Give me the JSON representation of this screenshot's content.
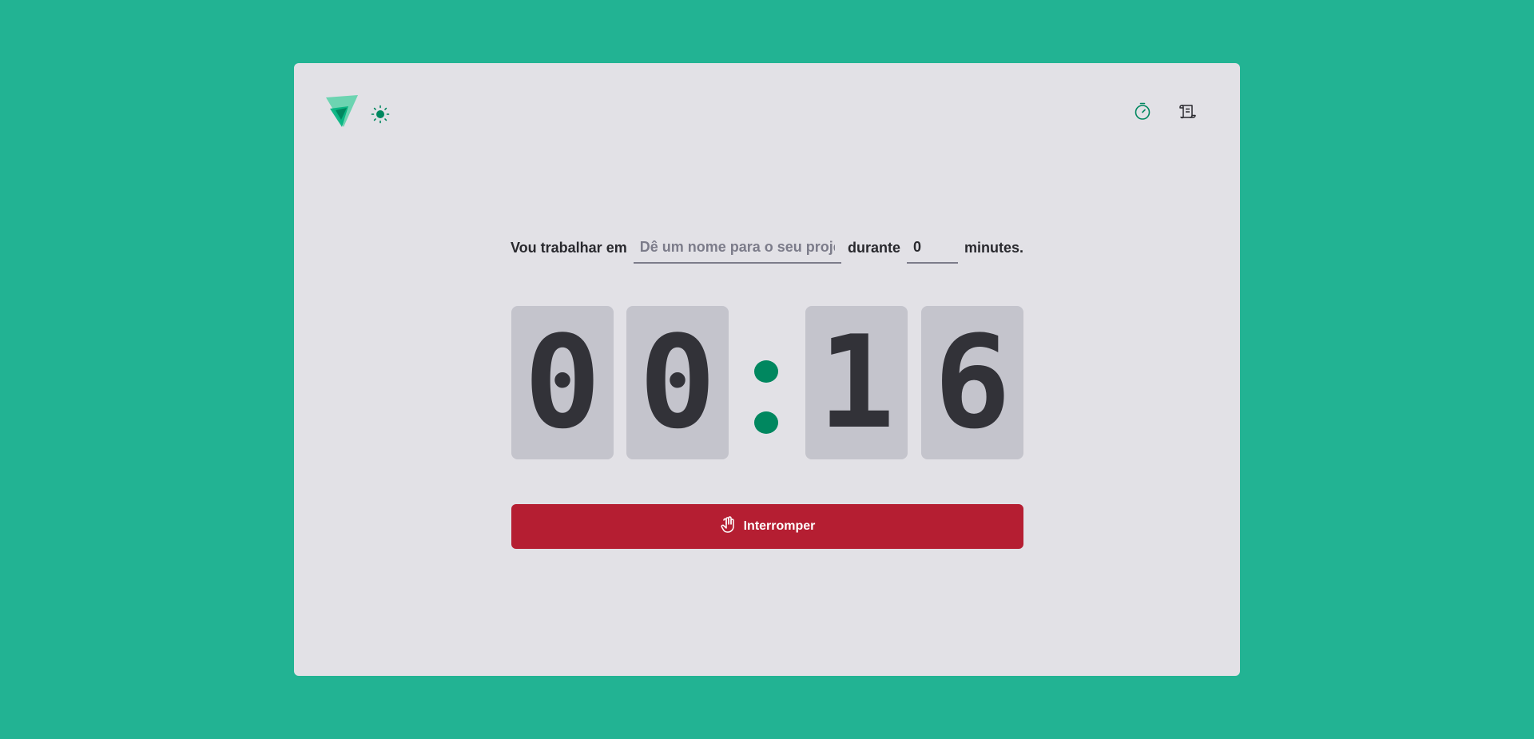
{
  "header": {
    "logo_icon": "app-logo-icon",
    "theme_icon": "sun-icon",
    "nav": [
      {
        "icon": "timer-icon",
        "color": "#00875f"
      },
      {
        "icon": "scroll-icon",
        "color": "#29292e"
      }
    ]
  },
  "form": {
    "prefix": "Vou trabalhar em",
    "project_placeholder": "Dê um nome para o seu projeto",
    "project_value": "",
    "middle": "durante",
    "minutes_value": "0",
    "suffix": "minutes."
  },
  "countdown": {
    "minutes_tens": "0",
    "minutes_ones": "0",
    "separator": ":",
    "seconds_tens": "1",
    "seconds_ones": "6"
  },
  "actions": {
    "stop_label": "Interromper",
    "stop_icon": "hand-palm-icon"
  },
  "colors": {
    "background": "#22b393",
    "card": "#e2e1e6",
    "accent": "#00875f",
    "digit_bg": "#c4c4cc",
    "danger": "#b51e32"
  }
}
